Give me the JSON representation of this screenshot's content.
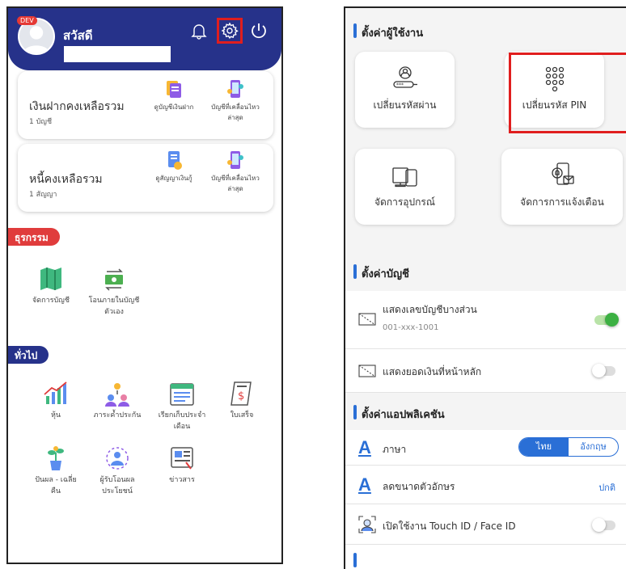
{
  "left": {
    "header": {
      "dev_badge": "DEV",
      "greeting": "สวัสดี"
    },
    "deposit_card": {
      "title": "เงินฝากคงเหลือรวม",
      "count": "1 บัญชี",
      "action1": "ดูบัญชีเงินฝาก",
      "action2_line1": "บัญชีที่เคลื่อนไหว",
      "action2_line2": "ล่าสุด"
    },
    "loan_card": {
      "title": "หนี้คงเหลือรวม",
      "count": "1 สัญญา",
      "action1": "ดูสัญญาเงินกู้",
      "action2_line1": "บัญชีที่เคลื่อนไหว",
      "action2_line2": "ล่าสุด"
    },
    "transactions": {
      "heading": "ธุรกรรม",
      "items": [
        {
          "line1": "จัดการบัญชี",
          "line2": ""
        },
        {
          "line1": "โอนภายในบัญชี",
          "line2": "ตัวเอง"
        }
      ]
    },
    "general": {
      "heading": "ทั่วไป",
      "items": [
        {
          "line1": "หุ้น",
          "line2": ""
        },
        {
          "line1": "ภาระค้ำประกัน",
          "line2": ""
        },
        {
          "line1": "เรียกเก็บประจำ",
          "line2": "เดือน"
        },
        {
          "line1": "ใบเสร็จ",
          "line2": ""
        },
        {
          "line1": "ปันผล - เฉลี่ย",
          "line2": "คืน"
        },
        {
          "line1": "ผู้รับโอนผล",
          "line2": "ประโยชน์"
        },
        {
          "line1": "ข่าวสาร",
          "line2": ""
        }
      ]
    }
  },
  "right": {
    "user_settings": {
      "heading": "ตั้งค่าผู้ใช้งาน",
      "change_password": "เปลี่ยนรหัสผ่าน",
      "change_pin": "เปลี่ยนรหัส PIN",
      "manage_devices": "จัดการอุปกรณ์",
      "manage_notifications": "จัดการการแจ้งเตือน"
    },
    "account_settings": {
      "heading": "ตั้งค่าบัญชี",
      "show_partial_number": "แสดงเลขบัญชีบางส่วน",
      "account_number": "001-xxx-1001",
      "partial_number_enabled": true,
      "show_balance_home": "แสดงยอดเงินที่หน้าหลัก",
      "balance_home_enabled": false
    },
    "app_settings": {
      "heading": "ตั้งค่าแอปพลิเคชัน",
      "language_label": "ภาษา",
      "language_options": [
        "ไทย",
        "อังกฤษ"
      ],
      "language_selected": "ไทย",
      "font_size_label": "ลดขนาดตัวอักษร",
      "font_size_value": "ปกติ",
      "biometric_label": "เปิดใช้งาน Touch ID / Face ID",
      "biometric_enabled": false
    }
  },
  "colors": {
    "header_navy": "#26328a",
    "accent_blue": "#2a6fd6",
    "section_red": "#e03c3c",
    "highlight_red": "#e01e1e",
    "toggle_green": "#3cb043"
  }
}
